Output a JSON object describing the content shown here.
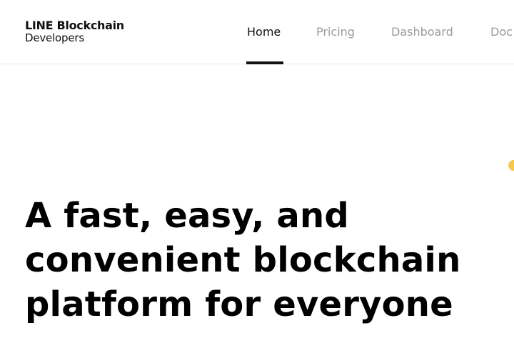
{
  "header": {
    "logo": {
      "line1": "LINE Blockchain",
      "line2": "Developers"
    },
    "nav": {
      "items": [
        {
          "label": "Home",
          "active": true
        },
        {
          "label": "Pricing",
          "active": false
        },
        {
          "label": "Dashboard",
          "active": false
        },
        {
          "label": "Doc",
          "active": false
        }
      ]
    }
  },
  "hero": {
    "title_lines": [
      "A fast, easy, and",
      "convenient blockchain",
      "platform for everyone"
    ]
  },
  "colors": {
    "text": "#000000",
    "nav_inactive": "#9b9b9b",
    "accent": "#f7c948",
    "divider": "#ececec"
  }
}
